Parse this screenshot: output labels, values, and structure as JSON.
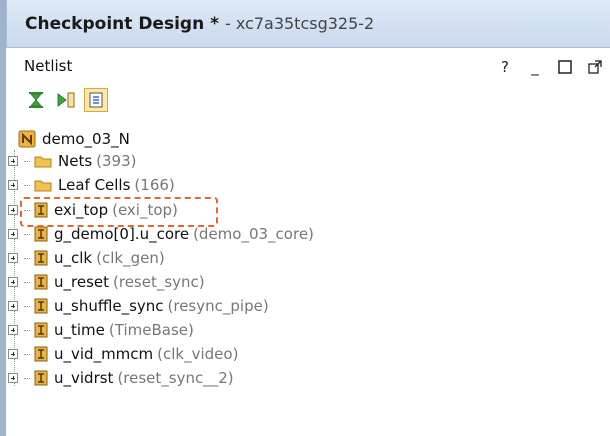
{
  "window": {
    "title": "Checkpoint Design *",
    "subtitle": "- xc7a35tcsg325-2"
  },
  "panel": {
    "name": "Netlist",
    "controls": [
      "?",
      "_",
      "□",
      "↗"
    ]
  },
  "toolbar": {
    "buttons": [
      {
        "icon": "collapse-all-icon"
      },
      {
        "icon": "expand-selected-icon"
      },
      {
        "icon": "show-hierarchy-icon",
        "active": true
      }
    ]
  },
  "tree": {
    "root": "demo_03_N",
    "items": [
      {
        "name": "Nets",
        "detail": "(393)",
        "icon": "folder-icon"
      },
      {
        "name": "Leaf Cells",
        "detail": "(166)",
        "icon": "folder-icon"
      },
      {
        "name": "exi_top",
        "detail": "(exi_top)",
        "icon": "cell-icon",
        "highlighted": true
      },
      {
        "name": "g_demo[0].u_core",
        "detail": "(demo_03_core)",
        "icon": "cell-icon"
      },
      {
        "name": "u_clk",
        "detail": "(clk_gen)",
        "icon": "cell-icon"
      },
      {
        "name": "u_reset",
        "detail": "(reset_sync)",
        "icon": "cell-icon"
      },
      {
        "name": "u_shuffle_sync",
        "detail": "(resync_pipe)",
        "icon": "cell-icon"
      },
      {
        "name": "u_time",
        "detail": "(TimeBase)",
        "icon": "cell-icon"
      },
      {
        "name": "u_vid_mmcm",
        "detail": "(clk_video)",
        "icon": "cell-icon"
      },
      {
        "name": "u_vidrst",
        "detail": "(reset_sync__2)",
        "icon": "cell-icon"
      }
    ]
  },
  "colors": {
    "title_bg": "#c9d9ee",
    "highlight": "#e06a2b",
    "folder": "#f2c14e",
    "cell": "#e8b44a"
  }
}
